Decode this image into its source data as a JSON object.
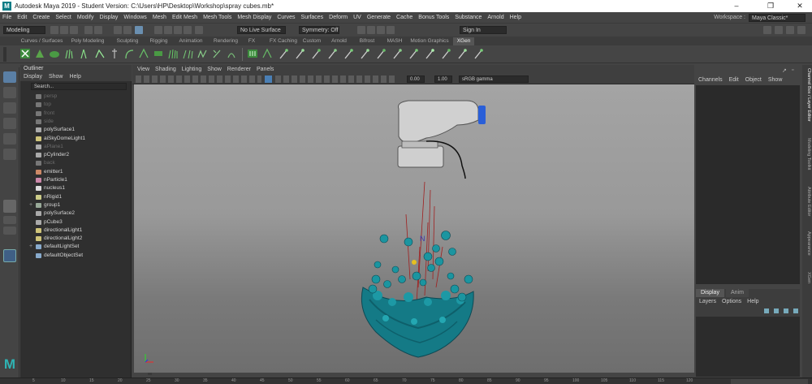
{
  "titlebar": {
    "title": "Autodesk Maya 2019 - Student Version: C:\\Users\\HP\\Desktop\\Workshop\\spray cubes.mb*",
    "minimize": "–",
    "maximize": "❐",
    "close": "✕"
  },
  "menus": [
    "File",
    "Edit",
    "Create",
    "Select",
    "Modify",
    "Display",
    "Windows",
    "Mesh",
    "Edit Mesh",
    "Mesh Tools",
    "Mesh Display",
    "Curves",
    "Surfaces",
    "Deform",
    "UV",
    "Generate",
    "Cache",
    "Bonus Tools",
    "Substance",
    "Arnold",
    "Help"
  ],
  "workspace": {
    "label": "Workspace :",
    "value": "Maya Classic*"
  },
  "statusline": {
    "menu_set": "Modeling",
    "live_surface": "No Live Surface",
    "symmetry": "Symmetry: Off",
    "sign_in": "Sign In"
  },
  "shelf_tabs": [
    "Curves / Surfaces",
    "Poly Modeling",
    "Sculpting",
    "Rigging",
    "Animation",
    "Rendering",
    "FX",
    "FX Caching",
    "Custom",
    "Arnold",
    "Bifrost",
    "MASH",
    "Motion Graphics",
    "XGen"
  ],
  "shelf_active": "XGen",
  "outliner": {
    "title": "Outliner",
    "menus": [
      "Display",
      "Show",
      "Help"
    ],
    "search_placeholder": "Search...",
    "items": [
      {
        "label": "persp",
        "icon": "camera-icon",
        "dim": true
      },
      {
        "label": "top",
        "icon": "camera-icon",
        "dim": true
      },
      {
        "label": "front",
        "icon": "camera-icon",
        "dim": true
      },
      {
        "label": "side",
        "icon": "camera-icon",
        "dim": true
      },
      {
        "label": "polySurface1",
        "icon": "mesh-icon",
        "dim": false
      },
      {
        "label": "aiSkyDomeLight1",
        "icon": "light-icon",
        "dim": false
      },
      {
        "label": "aPlane1",
        "icon": "mesh-icon",
        "dim": true
      },
      {
        "label": "pCylinder2",
        "icon": "mesh-icon",
        "dim": false
      },
      {
        "label": "back",
        "icon": "camera-icon",
        "dim": true
      },
      {
        "label": "emitter1",
        "icon": "emitter-icon",
        "dim": false
      },
      {
        "label": "nParticle1",
        "icon": "particle-icon",
        "dim": false
      },
      {
        "label": "nucleus1",
        "icon": "nucleus-icon",
        "dim": false
      },
      {
        "label": "nRigid1",
        "icon": "rigid-icon",
        "dim": false
      },
      {
        "label": "group1",
        "icon": "group-icon",
        "dim": false,
        "expand": "+"
      },
      {
        "label": "polySurface2",
        "icon": "mesh-icon",
        "dim": false
      },
      {
        "label": "pCube3",
        "icon": "mesh-icon",
        "dim": false
      },
      {
        "label": "directionalLight1",
        "icon": "light-icon",
        "dim": false
      },
      {
        "label": "directionalLight2",
        "icon": "light-icon",
        "dim": false
      },
      {
        "label": "defaultLightSet",
        "icon": "set-icon",
        "dim": false,
        "expand": "+"
      },
      {
        "label": "defaultObjectSet",
        "icon": "set-icon",
        "dim": false
      }
    ]
  },
  "viewport": {
    "menus": [
      "View",
      "Shading",
      "Lighting",
      "Show",
      "Renderer",
      "Panels"
    ],
    "exposure": "0.00",
    "gamma": "1.00",
    "colorspace": "sRGB gamma"
  },
  "channelbox": {
    "menus": [
      "Channels",
      "Edit",
      "Object",
      "Show"
    ]
  },
  "layers": {
    "tabs": [
      "Display",
      "Anim"
    ],
    "menus": [
      "Layers",
      "Options",
      "Help"
    ]
  },
  "side_tabs": [
    "Channel Box / Layer Editor",
    "Modeling Toolkit",
    "Attribute Editor",
    "Appearance",
    "XGen"
  ],
  "timeline": {
    "ticks": [
      "5",
      "10",
      "15",
      "20",
      "25",
      "30",
      "35",
      "40",
      "45",
      "50",
      "55",
      "60",
      "65",
      "70",
      "75",
      "80",
      "85",
      "90",
      "95",
      "100",
      "105",
      "110",
      "115",
      "120"
    ]
  },
  "colors": {
    "accent": "#2fb3b3",
    "cyan_blobs": "#1a8c97",
    "bottle_cap": "#2a5fd8"
  }
}
